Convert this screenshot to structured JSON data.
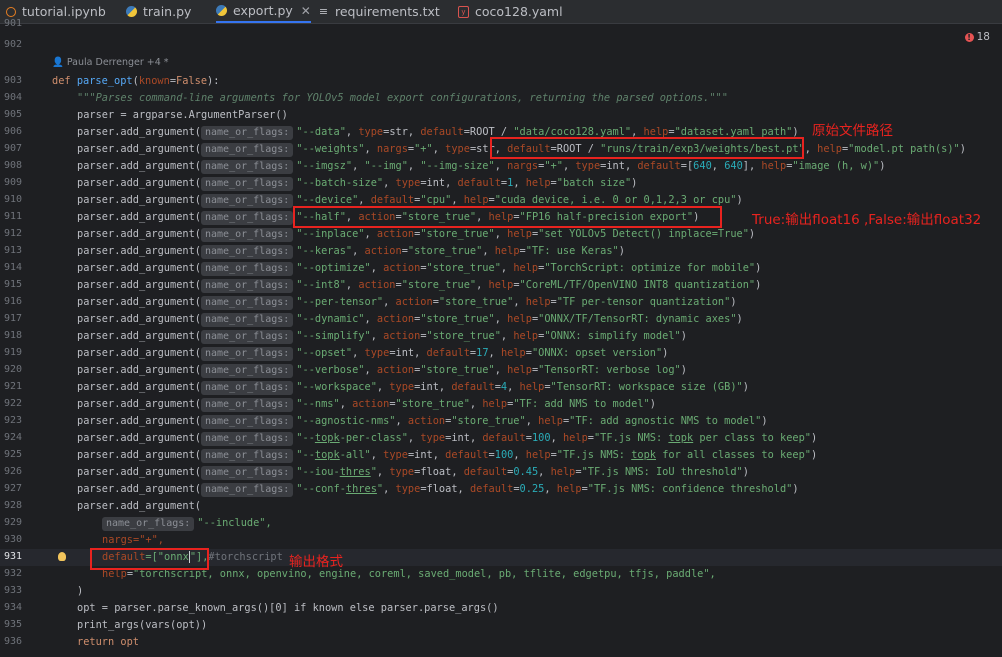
{
  "tabs": [
    {
      "label": "tutorial.ipynb",
      "icon": "notebook-icon",
      "active": false
    },
    {
      "label": "train.py",
      "icon": "python-file-icon",
      "active": false
    },
    {
      "label": "export.py",
      "icon": "python-file-icon",
      "active": true
    },
    {
      "label": "requirements.txt",
      "icon": "text-file-icon",
      "active": false
    },
    {
      "label": "coco128.yaml",
      "icon": "yaml-file-icon",
      "active": false
    }
  ],
  "problems_count": "18",
  "author_hint": "Paula Derrenger +4 *",
  "line_numbers": [
    "901",
    "902",
    "903",
    "904",
    "905",
    "906",
    "907",
    "908",
    "909",
    "910",
    "911",
    "912",
    "913",
    "914",
    "915",
    "916",
    "917",
    "918",
    "919",
    "920",
    "921",
    "922",
    "923",
    "924",
    "925",
    "926",
    "927",
    "928",
    "929",
    "930",
    "931",
    "932",
    "933",
    "934",
    "935",
    "936"
  ],
  "current_line": "931",
  "hint_label": "name_or_flags:",
  "code": {
    "def_kw": "def",
    "func_name": "parse_opt",
    "param": "known",
    "param_default": "False",
    "docstring": "\"\"\"Parses command-line arguments for YOLOv5 model export configurations, returning the parsed options.\"\"\"",
    "parser_init": "parser = argparse.ArgumentParser()",
    "add_arg": "parser.add_argument(",
    "include_flag": "\"--include\",",
    "nargs_line": "nargs=\"+\",",
    "default_line_kw": "default",
    "default_line_val": "=[\"onnx",
    "default_line_rest": "\"],",
    "default_line_ghost": "#torchscript",
    "help_line_kw": "help",
    "help_line_val": "\"torchscript, onnx, openvino, engine, coreml, saved_model, pb, tflite, edgetpu, tfjs, paddle\",",
    "close_paren": ")",
    "opt_line": "opt = parser.parse_known_args()[0] if known else parser.parse_args()",
    "print_line": "print_args(vars(opt))",
    "return_line": "return opt"
  },
  "annotations": {
    "weights_note": "原始文件路径",
    "half_note": "True:输出float16 ,False:输出float32",
    "format_note": "输出格式"
  }
}
